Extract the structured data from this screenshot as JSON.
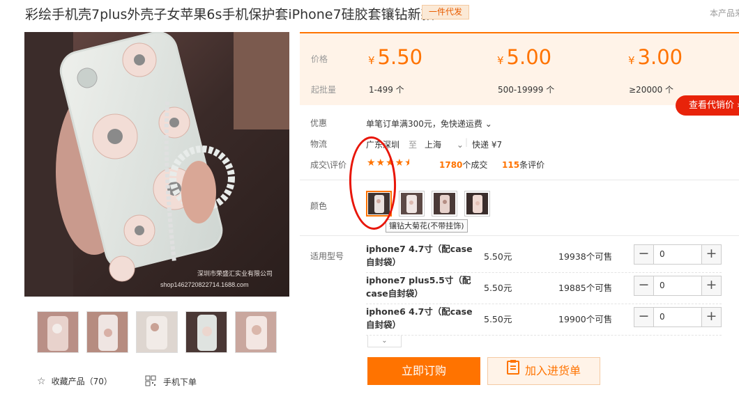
{
  "product": {
    "title": "彩绘手机壳7plus外壳子女苹果6s手机保护套iPhone7硅胶套镶钻新款",
    "badge": "一件代发",
    "top_right_text": "本产品来"
  },
  "image_watermark": {
    "line1": "深圳市荣盛汇实业有限公司",
    "line2": "shop1462720822714.1688.com"
  },
  "gallery": {
    "favorite_label": "收藏产品（70）",
    "mobile_order_label": "手机下单"
  },
  "price": {
    "price_label": "价格",
    "moq_label": "起批量",
    "currency": "¥",
    "tiers": [
      {
        "price": "5.50",
        "qty": "1-499 个"
      },
      {
        "price": "5.00",
        "qty": "500-19999 个"
      },
      {
        "price": "3.00",
        "qty": "≥20000 个"
      }
    ],
    "agent_button": "查看代销价 ›"
  },
  "promo": {
    "label": "优惠",
    "text": "单笔订单满300元，免快递运费 ⌄"
  },
  "logistics": {
    "label": "物流",
    "from": "广东深圳",
    "to_word": "至",
    "to": "上海",
    "express": "快递 ¥7"
  },
  "deals": {
    "label": "成交\\评价",
    "rating": 4.5,
    "sold_count": "1780",
    "sold_suffix": "个成交",
    "review_count": "115",
    "review_suffix": "条评价"
  },
  "color": {
    "label": "颜色",
    "selected_tooltip": "镶钻大菊花(不带挂饰)"
  },
  "models": {
    "label": "适用型号",
    "rows": [
      {
        "name": "iphone7 4.7寸（配case自封袋）",
        "price": "5.50元",
        "stock": "19938个可售",
        "qty": "0"
      },
      {
        "name": "iphone7 plus5.5寸（配case自封袋）",
        "price": "5.50元",
        "stock": "19885个可售",
        "qty": "0"
      },
      {
        "name": "iphone6 4.7寸（配case自封袋）",
        "price": "5.50元",
        "stock": "19900个可售",
        "qty": "0"
      }
    ]
  },
  "actions": {
    "buy_now": "立即订购",
    "add_to_cart": "加入进货单"
  },
  "colors": {
    "accent": "#ff7300",
    "price_bg": "#fff3e8",
    "red": "#e8230a"
  }
}
